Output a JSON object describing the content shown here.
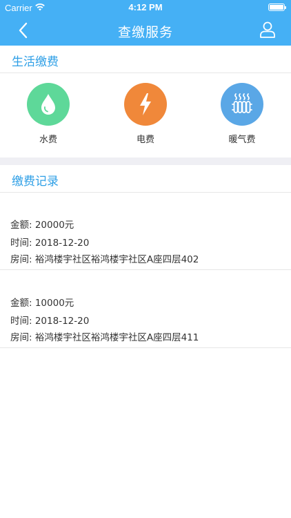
{
  "status_bar": {
    "carrier": "Carrier",
    "time": "4:12 PM"
  },
  "nav": {
    "title": "查缴服务",
    "back_icon": "chevron-left-icon",
    "user_icon": "user-icon"
  },
  "colors": {
    "header": "#45b0f5",
    "section_title": "#2e9fe6",
    "water": "#5ed899",
    "electricity": "#f0883a",
    "heating": "#5aa7e6",
    "band": "#efeff4"
  },
  "living_payment": {
    "title": "生活缴费",
    "items": [
      {
        "label": "水费",
        "icon": "water-drop-icon"
      },
      {
        "label": "电费",
        "icon": "lightning-icon"
      },
      {
        "label": "暖气费",
        "icon": "radiator-icon"
      }
    ]
  },
  "payment_records": {
    "title": "缴费记录",
    "records": [
      {
        "amount": "金额: 20000元",
        "time": "时间: 2018-12-20",
        "room": "房间: 裕鸿楼宇社区裕鸿楼宇社区A座四层402"
      },
      {
        "amount": "金额: 10000元",
        "time": "时间: 2018-12-20",
        "room": "房间: 裕鸿楼宇社区裕鸿楼宇社区A座四层411"
      }
    ]
  }
}
